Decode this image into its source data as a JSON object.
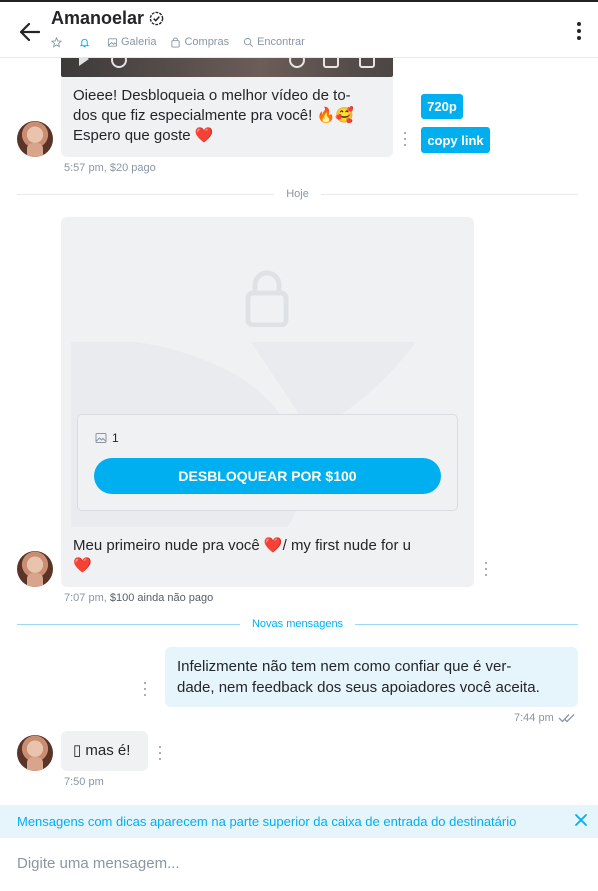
{
  "header": {
    "title": "Amanoelar",
    "tabs": [
      {
        "label": "",
        "icon": "star-icon"
      },
      {
        "label": "",
        "icon": "bell-icon"
      },
      {
        "label": "Galeria",
        "icon": "image-icon"
      },
      {
        "label": "Compras",
        "icon": "bag-icon"
      },
      {
        "label": "Encontrar",
        "icon": "search-icon"
      }
    ]
  },
  "messages": [
    {
      "text": "Oieee! Desbloqueia o melhor vídeo de to-dos que fiz especialmente pra você! 🔥🥰 Espero que goste ❤️",
      "line1": "Oieee! Desbloqueia o melhor vídeo de to-",
      "line2": "dos que fiz especialmente pra você! 🔥🥰",
      "line3": "Espero que goste ❤️",
      "time": "5:57 pm,",
      "price_status": "$20 pago",
      "quality_button": "720p",
      "copy_link_button": "copy link"
    },
    {
      "line1": "Meu primeiro nude pra você ❤️/ my first nude for u",
      "line2": "❤️",
      "time": "7:07 pm,",
      "price_status": "$100 ainda não pago",
      "media_count": "1",
      "unlock_button": "DESBLOQUEAR POR $100"
    },
    {
      "line1": "Infelizmente não tem nem como confiar que é ver-",
      "line2": "dade, nem feedback dos seus apoiadores você aceita.",
      "time": "7:44 pm"
    },
    {
      "text": "▯ mas é!",
      "time": "7:50 pm"
    }
  ],
  "dividers": {
    "today": "Hoje",
    "new_messages": "Novas mensagens"
  },
  "tip_bar": {
    "text": "Mensagens com dicas aparecem na parte superior da caixa de entrada do destinatário"
  },
  "compose": {
    "placeholder": "Digite uma mensagem..."
  },
  "colors": {
    "accent": "#00aff0",
    "bubble_in": "#f0f1f3",
    "bubble_out": "#e6f4fc",
    "muted": "#8a96a3"
  }
}
